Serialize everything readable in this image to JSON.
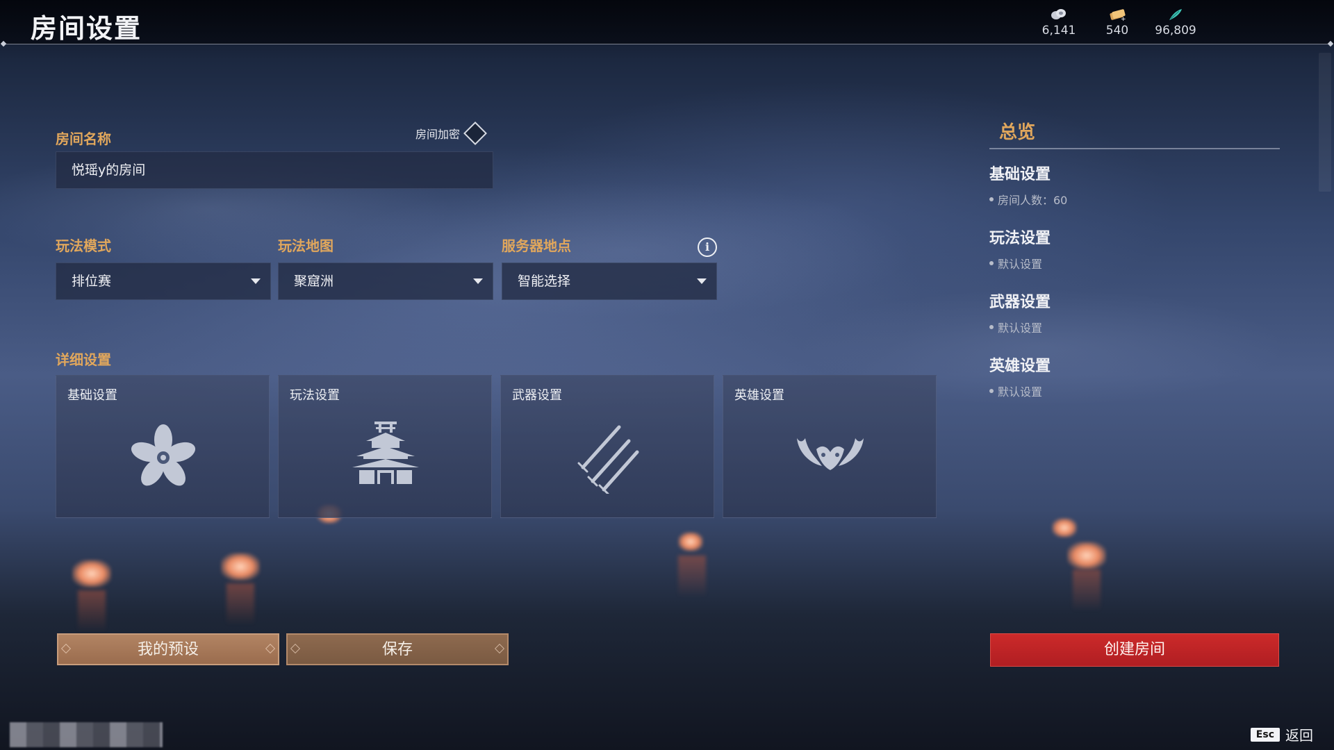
{
  "header": {
    "title": "房间设置",
    "currencies": [
      {
        "icon": "coin-pile-icon",
        "value": "6,141"
      },
      {
        "icon": "gold-ticket-icon",
        "value": "540"
      },
      {
        "icon": "jade-feather-icon",
        "value": "96,809"
      }
    ]
  },
  "room": {
    "name_label": "房间名称",
    "name_value": "悦瑶y的房间",
    "encrypt_label": "房间加密"
  },
  "selectors": {
    "mode_label": "玩法模式",
    "mode_value": "排位赛",
    "map_label": "玩法地图",
    "map_value": "聚窟洲",
    "server_label": "服务器地点",
    "server_value": "智能选择"
  },
  "details": {
    "label": "详细设置",
    "cards": [
      {
        "label": "基础设置",
        "icon": "flower-icon"
      },
      {
        "label": "玩法设置",
        "icon": "pagoda-icon"
      },
      {
        "label": "武器设置",
        "icon": "swords-icon"
      },
      {
        "label": "英雄设置",
        "icon": "demon-mask-icon"
      }
    ]
  },
  "buttons": {
    "preset": "我的预设",
    "save": "保存",
    "create": "创建房间"
  },
  "summary": {
    "title": "总览",
    "sections": [
      {
        "heading": "基础设置",
        "item": "房间人数：60"
      },
      {
        "heading": "玩法设置",
        "item": "默认设置"
      },
      {
        "heading": "武器设置",
        "item": "默认设置"
      },
      {
        "heading": "英雄设置",
        "item": "默认设置"
      }
    ]
  },
  "footer": {
    "esc_key": "Esc",
    "esc_label": "返回"
  },
  "colors": {
    "accent_gold": "#e1a75c",
    "create_red": "#c02226",
    "button_bronze": "#a67658"
  }
}
